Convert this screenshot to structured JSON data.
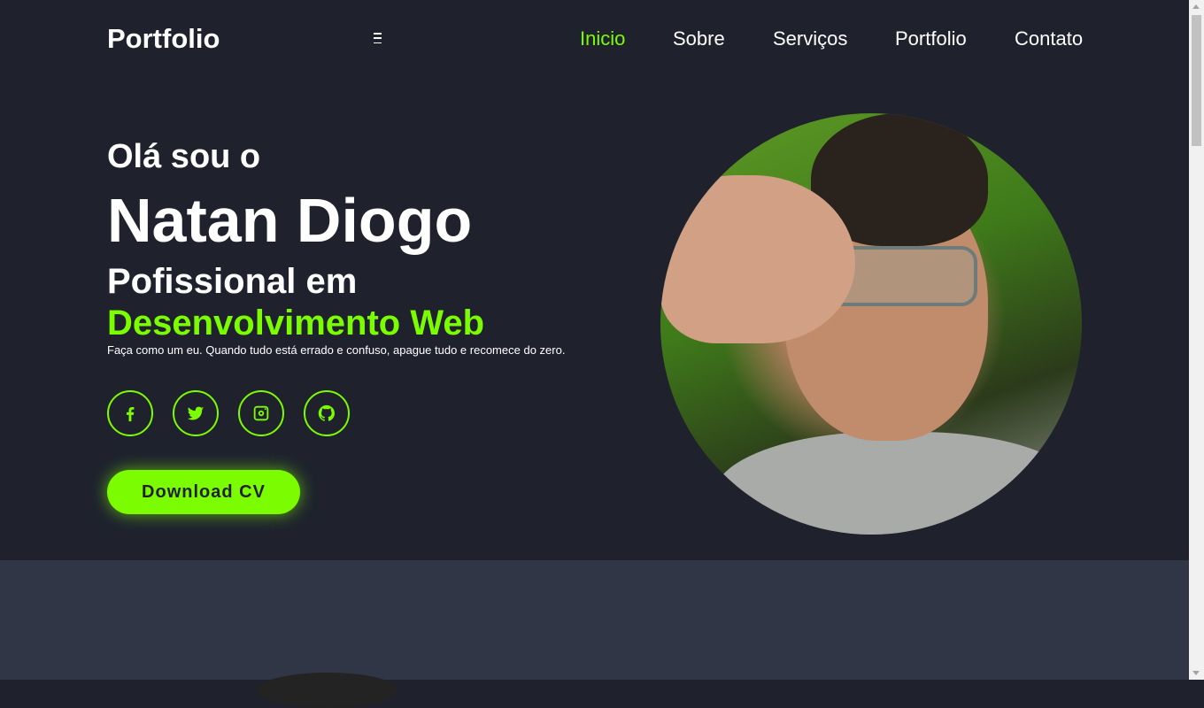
{
  "header": {
    "logo": "Portfolio",
    "menu_icon": "hamburger-icon",
    "nav": [
      {
        "label": "Inicio",
        "active": true
      },
      {
        "label": "Sobre",
        "active": false
      },
      {
        "label": "Serviços",
        "active": false
      },
      {
        "label": "Portfolio",
        "active": false
      },
      {
        "label": "Contato",
        "active": false
      }
    ]
  },
  "hero": {
    "greeting": "Olá sou o",
    "name": "Natan Diogo",
    "role": "Pofissional em",
    "role_highlight": "Desenvolvimento Web",
    "tagline": "Faça como um eu. Quando tudo está errado e confuso, apague tudo e recomece do zero.",
    "socials": [
      {
        "icon": "facebook-icon"
      },
      {
        "icon": "twitter-icon"
      },
      {
        "icon": "instagram-icon"
      },
      {
        "icon": "github-icon"
      }
    ],
    "cta": "Download CV",
    "photo": "profile-photo"
  },
  "colors": {
    "background": "#1f222d",
    "accent": "#7cfc00",
    "section_bg": "#313646",
    "text": "#ffffff"
  }
}
